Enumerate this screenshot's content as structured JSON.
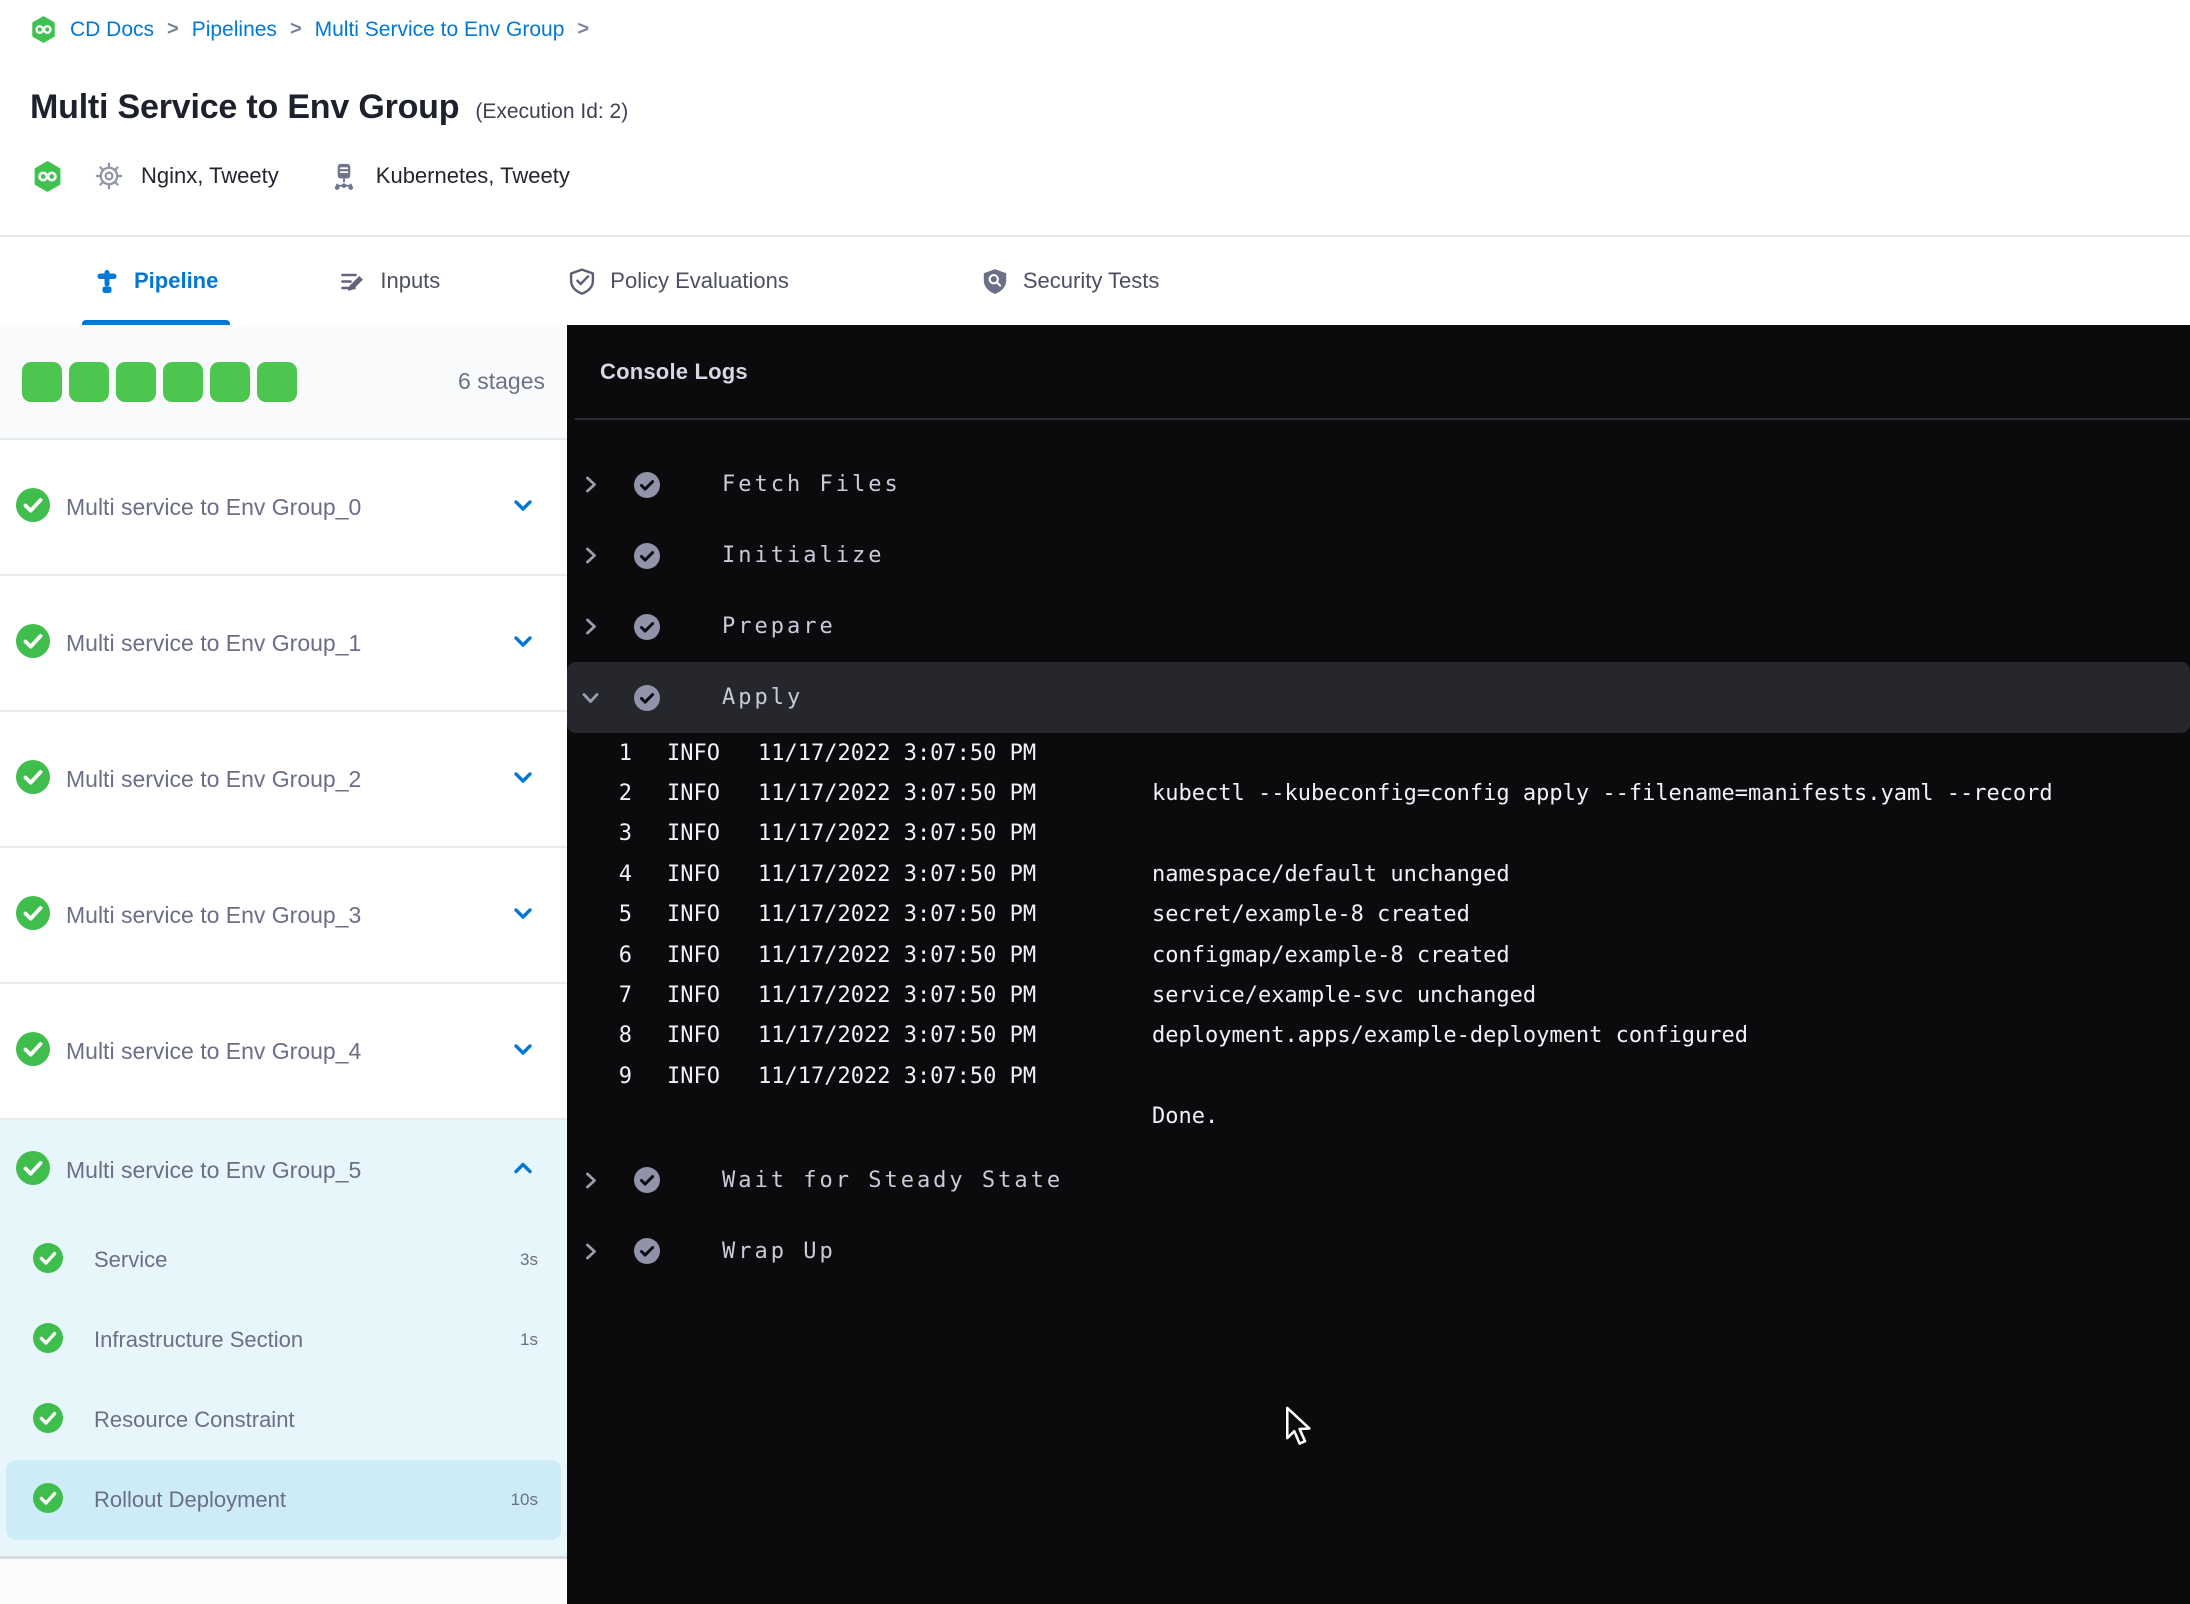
{
  "colors": {
    "accent-blue": "#0278d5",
    "success-green": "#3fbe4e",
    "square-green": "#4cc64e",
    "title-dark": "#1d212e",
    "gray-text": "#6b6e87",
    "tab-text": "#4c4f63",
    "console-bg": "#0b0b0d",
    "console-text": "#c9cbdb",
    "log-text": "#f2f2f6",
    "selected-cyan": "#cdecf7",
    "expanded-cyan": "#e7f6fb"
  },
  "breadcrumb": {
    "items": [
      "CD Docs",
      "Pipelines",
      "Multi Service to Env Group"
    ],
    "separator": ">"
  },
  "header": {
    "title": "Multi Service to Env Group",
    "execution_id": "(Execution Id: 2)",
    "services_label": "Nginx, Tweety",
    "infrastructure_label": "Kubernetes, Tweety"
  },
  "tabs": [
    {
      "label": "Pipeline",
      "active": true
    },
    {
      "label": "Inputs",
      "active": false
    },
    {
      "label": "Policy Evaluations",
      "active": false
    },
    {
      "label": "Security Tests",
      "active": false
    }
  ],
  "stages_panel": {
    "stage_count": 6,
    "count_label": "6 stages",
    "stages": [
      {
        "name": "Multi service to Env Group_0",
        "expanded": false
      },
      {
        "name": "Multi service to Env Group_1",
        "expanded": false
      },
      {
        "name": "Multi service to Env Group_2",
        "expanded": false
      },
      {
        "name": "Multi service to Env Group_3",
        "expanded": false
      },
      {
        "name": "Multi service to Env Group_4",
        "expanded": false
      },
      {
        "name": "Multi service to Env Group_5",
        "expanded": true,
        "steps": [
          {
            "name": "Service",
            "duration": "3s",
            "selected": false
          },
          {
            "name": "Infrastructure Section",
            "duration": "1s",
            "selected": false
          },
          {
            "name": "Resource Constraint",
            "duration": "",
            "selected": false
          },
          {
            "name": "Rollout Deployment",
            "duration": "10s",
            "selected": true
          }
        ]
      }
    ]
  },
  "console": {
    "title": "Console Logs",
    "steps": [
      {
        "name": "Fetch Files",
        "expanded": false
      },
      {
        "name": "Initialize",
        "expanded": false
      },
      {
        "name": "Prepare",
        "expanded": false
      },
      {
        "name": "Apply",
        "expanded": true,
        "logs": [
          {
            "line": "1",
            "level": "INFO",
            "time": "11/17/2022 3:07:50 PM",
            "message": ""
          },
          {
            "line": "2",
            "level": "INFO",
            "time": "11/17/2022 3:07:50 PM",
            "message": "kubectl --kubeconfig=config apply --filename=manifests.yaml --record"
          },
          {
            "line": "3",
            "level": "INFO",
            "time": "11/17/2022 3:07:50 PM",
            "message": ""
          },
          {
            "line": "4",
            "level": "INFO",
            "time": "11/17/2022 3:07:50 PM",
            "message": "namespace/default unchanged"
          },
          {
            "line": "5",
            "level": "INFO",
            "time": "11/17/2022 3:07:50 PM",
            "message": "secret/example-8 created"
          },
          {
            "line": "6",
            "level": "INFO",
            "time": "11/17/2022 3:07:50 PM",
            "message": "configmap/example-8 created"
          },
          {
            "line": "7",
            "level": "INFO",
            "time": "11/17/2022 3:07:50 PM",
            "message": "service/example-svc unchanged"
          },
          {
            "line": "8",
            "level": "INFO",
            "time": "11/17/2022 3:07:50 PM",
            "message": "deployment.apps/example-deployment configured"
          },
          {
            "line": "9",
            "level": "INFO",
            "time": "11/17/2022 3:07:50 PM",
            "message": ""
          },
          {
            "line": "",
            "level": "",
            "time": "",
            "message": "Done."
          }
        ]
      },
      {
        "name": "Wait for Steady State",
        "expanded": false
      },
      {
        "name": "Wrap Up",
        "expanded": false
      }
    ]
  }
}
